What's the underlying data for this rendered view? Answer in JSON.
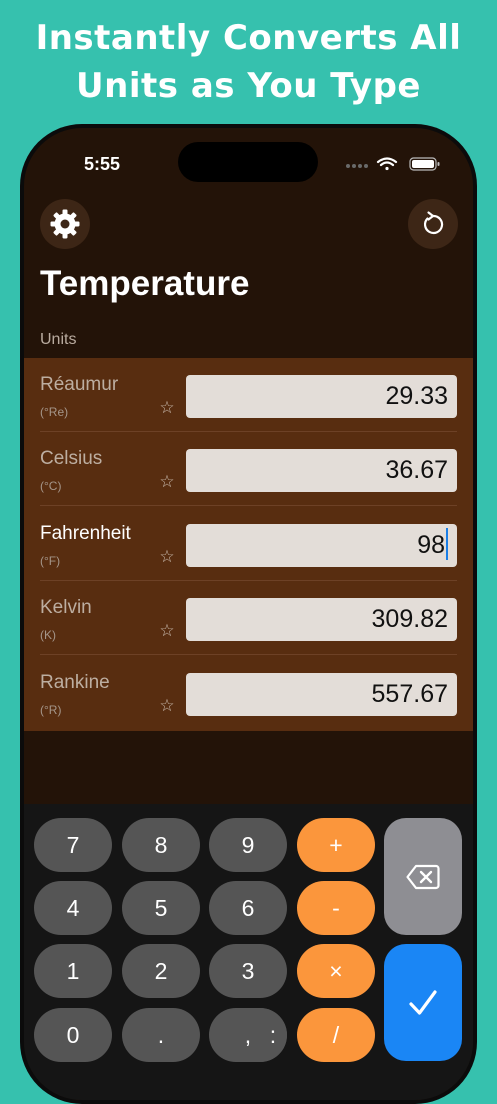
{
  "banner": {
    "line1": "Instantly Converts All",
    "line2": "Units as You Type"
  },
  "status_bar": {
    "time": "5:55",
    "icons": [
      "cellular-icon",
      "wifi-icon",
      "battery-icon"
    ]
  },
  "toolbar": {
    "settings_icon": "gear-icon",
    "reset_icon": "reset-icon"
  },
  "page": {
    "title": "Temperature",
    "section_label": "Units"
  },
  "units": [
    {
      "name": "Réaumur",
      "symbol": "(°Re)",
      "value": "29.33",
      "active": false
    },
    {
      "name": "Celsius",
      "symbol": "(°C)",
      "value": "36.67",
      "active": false
    },
    {
      "name": "Fahrenheit",
      "symbol": "(°F)",
      "value": "98",
      "active": true
    },
    {
      "name": "Kelvin",
      "symbol": "(K)",
      "value": "309.82",
      "active": false
    },
    {
      "name": "Rankine",
      "symbol": "(°R)",
      "value": "557.67",
      "active": false
    }
  ],
  "keypad": {
    "digits": [
      "7",
      "8",
      "9",
      "4",
      "5",
      "6",
      "1",
      "2",
      "3",
      "0",
      ".",
      ",",
      ":"
    ],
    "operators": [
      "+",
      "-",
      "×",
      "/"
    ],
    "backspace_icon": "backspace-icon",
    "done_icon": "checkmark-icon"
  },
  "colors": {
    "background": "#36c1ae",
    "screen": "#231308",
    "units_panel": "#582d10",
    "operator": "#fb963c",
    "done": "#1a86f5",
    "backspace": "#8e8e93",
    "caret": "#1a7ee6"
  }
}
